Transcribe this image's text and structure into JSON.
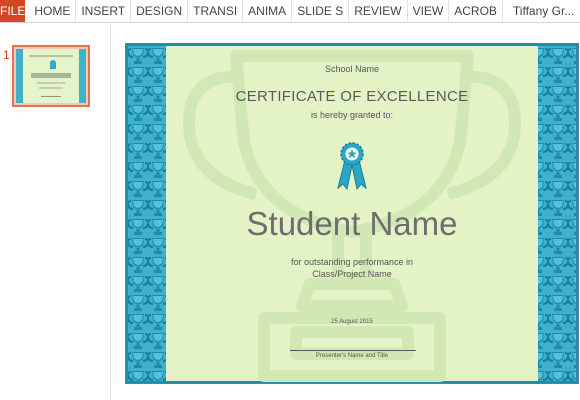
{
  "ribbon": {
    "file": "FILE",
    "tabs": [
      "HOME",
      "INSERT",
      "DESIGN",
      "TRANSI",
      "ANIMA",
      "SLIDE S",
      "REVIEW",
      "VIEW",
      "ACROB"
    ],
    "user": "Tiffany Gr..."
  },
  "thumbnails": {
    "slide_number": "1"
  },
  "slide": {
    "school_name": "School Name",
    "title": "CERTIFICATE OF EXCELLENCE",
    "granted": "is hereby granted to:",
    "student_name": "Student Name",
    "performance_line1": "for outstanding performance in",
    "performance_line2": "Class/Project Name",
    "date": "25 August 2015",
    "presenter": "Presenter's Name and Title"
  },
  "colors": {
    "file_tab": "#d24726",
    "border_teal": "#3fb1cc",
    "certificate_bg": "#e3f3c6",
    "trophy_watermark": "#d1e7b4"
  },
  "icons": {
    "award": "award-ribbon-icon",
    "trophy": "trophy-icon"
  }
}
